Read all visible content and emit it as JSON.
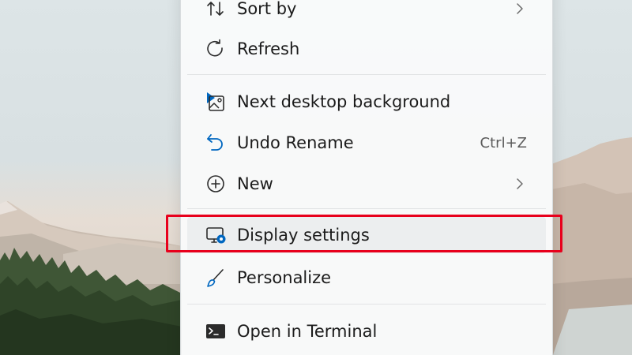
{
  "context_menu": {
    "items": [
      {
        "label": "Sort by",
        "icon": "sort-icon",
        "has_submenu": true
      },
      {
        "label": "Refresh",
        "icon": "refresh-icon"
      },
      {
        "label": "Next desktop background",
        "icon": "next-background-icon"
      },
      {
        "label": "Undo Rename",
        "icon": "undo-icon",
        "shortcut": "Ctrl+Z"
      },
      {
        "label": "New",
        "icon": "new-icon",
        "has_submenu": true
      },
      {
        "label": "Display settings",
        "icon": "display-settings-icon",
        "highlighted": true
      },
      {
        "label": "Personalize",
        "icon": "personalize-icon"
      },
      {
        "label": "Open in Terminal",
        "icon": "terminal-icon"
      }
    ]
  },
  "colors": {
    "highlight_border": "#e8001c",
    "icon_accent": "#0067c0",
    "menu_background": "#f9fafa"
  }
}
